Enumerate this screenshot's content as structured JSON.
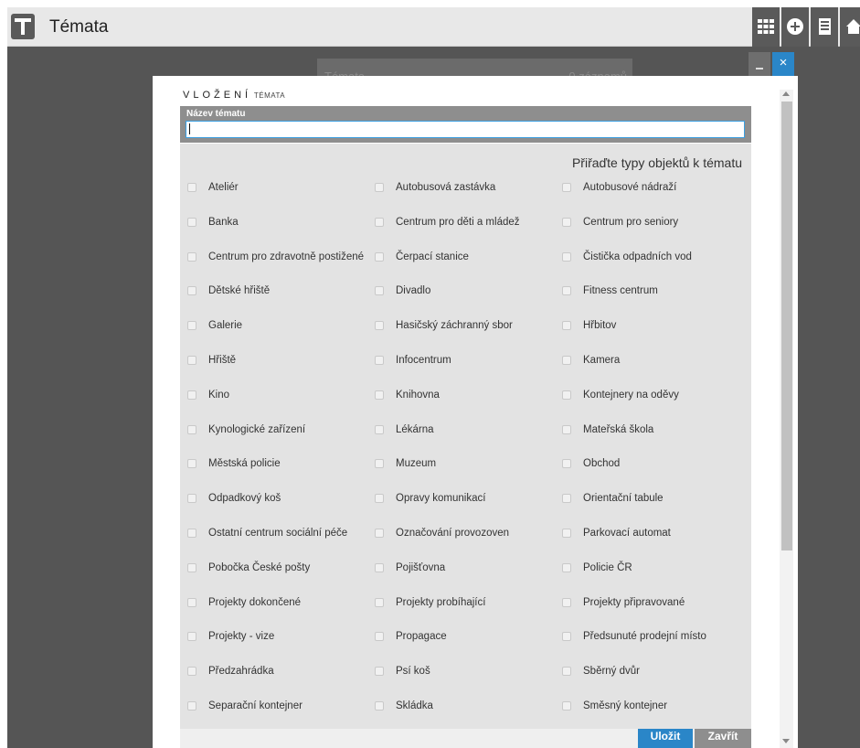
{
  "app": {
    "title": "Témata"
  },
  "toolbar_icons": [
    "grid-icon",
    "add-circle-icon",
    "document-icon",
    "home-icon"
  ],
  "background": {
    "panel_title": "Témata",
    "panel_count": "0 záznamů"
  },
  "dialog": {
    "heading_big": "VLOŽENÍ",
    "heading_small": "TÉMATA",
    "name_label": "Název tématu",
    "name_value": "",
    "assign_title": "Přiřaďte typy objektů k tématu",
    "save_label": "Uložit",
    "close_label": "Zavřít",
    "close_icon": "×",
    "options": [
      "Ateliér",
      "Autobusová zastávka",
      "Autobusové nádraží",
      "Banka",
      "Centrum pro děti a mládež",
      "Centrum pro seniory",
      "Centrum pro zdravotně postižené",
      "Čerpací stanice",
      "Čistička odpadních vod",
      "Dětské hřiště",
      "Divadlo",
      "Fitness centrum",
      "Galerie",
      "Hasičský záchranný sbor",
      "Hřbitov",
      "Hřiště",
      "Infocentrum",
      "Kamera",
      "Kino",
      "Knihovna",
      "Kontejnery na oděvy",
      "Kynologické zařízení",
      "Lékárna",
      "Mateřská škola",
      "Městská policie",
      "Muzeum",
      "Obchod",
      "Odpadkový koš",
      "Opravy komunikací",
      "Orientační tabule",
      "Ostatní centrum sociální péče",
      "Označování provozoven",
      "Parkovací automat",
      "Pobočka České pošty",
      "Pojišťovna",
      "Policie ČR",
      "Projekty dokončené",
      "Projekty probíhající",
      "Projekty připravované",
      "Projekty - vize",
      "Propagace",
      "Předsunuté prodejní místo",
      "Předzahrádka",
      "Psí koš",
      "Sběrný dvůr",
      "Separační kontejner",
      "Skládka",
      "Směsný kontejner"
    ]
  },
  "colors": {
    "accent": "#2a86c8",
    "dark_bg": "#555555",
    "panel": "#e3e3e3"
  }
}
